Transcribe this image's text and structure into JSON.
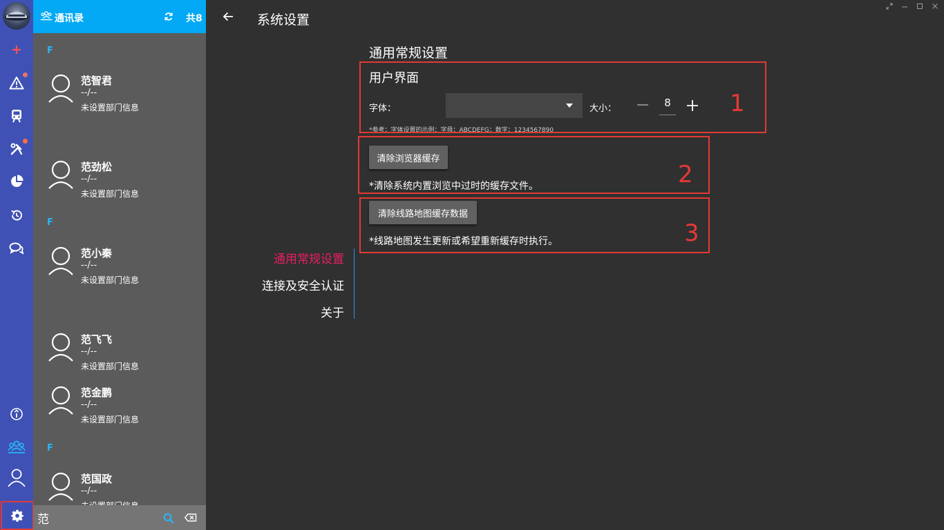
{
  "sidebar": {
    "items": [
      {
        "name": "add",
        "icon": "plus-icon"
      },
      {
        "name": "alarm",
        "icon": "warning-icon",
        "badge": true
      },
      {
        "name": "train",
        "icon": "train-icon"
      },
      {
        "name": "maintenance",
        "icon": "tools-icon",
        "badge": true
      },
      {
        "name": "statistics",
        "icon": "pie-chart-icon"
      },
      {
        "name": "history",
        "icon": "history-icon"
      },
      {
        "name": "chat",
        "icon": "chat-icon"
      },
      {
        "name": "info",
        "icon": "info-icon"
      },
      {
        "name": "contacts",
        "icon": "contacts-icon"
      },
      {
        "name": "profile",
        "icon": "person-icon"
      },
      {
        "name": "settings",
        "icon": "gear-icon"
      }
    ],
    "accent": "#3f51b5"
  },
  "contacts_panel": {
    "title": "通讯录",
    "count_label": "共8",
    "header_color": "#03a9f4",
    "groups": [
      "F",
      "F",
      "F"
    ],
    "contacts": [
      {
        "name": "范智君",
        "phone": "--/--",
        "dept": "未设置部门信息"
      },
      {
        "name": "范劲松",
        "phone": "--/--",
        "dept": "未设置部门信息"
      },
      {
        "name": "范小秦",
        "phone": "--/--",
        "dept": "未设置部门信息"
      },
      {
        "name": "范飞飞",
        "phone": "--/--",
        "dept": "未设置部门信息"
      },
      {
        "name": "范金鹏",
        "phone": "--/--",
        "dept": "未设置部门信息"
      },
      {
        "name": "范国政",
        "phone": "--/--",
        "dept": "未设置部门信息"
      }
    ],
    "search": {
      "value": "范",
      "placeholder": ""
    }
  },
  "main": {
    "title": "系统设置",
    "section_heading": "通用常规设置",
    "ui_section": {
      "title": "用户界面",
      "font_label": "字体：",
      "font_value": "",
      "size_label": "大小：",
      "size_value": "8",
      "hint": "*参考：字体设置的示例：字母：ABCDEFG；数字：1234567890"
    },
    "browser_cache": {
      "button_label": "清除浏览器缓存",
      "note": "*清除系统内置浏览中过时的缓存文件。"
    },
    "map_cache": {
      "button_label": "清除线路地图缓存数据",
      "note": "*线路地图发生更新或希望重新缓存时执行。"
    },
    "annotations": [
      "1",
      "2",
      "3"
    ],
    "nav": [
      {
        "label": "通用常规设置",
        "active": true
      },
      {
        "label": "连接及安全认证",
        "active": false
      },
      {
        "label": "关于",
        "active": false
      }
    ],
    "active_color": "#e91e63",
    "highlight_color": "#e53935"
  }
}
